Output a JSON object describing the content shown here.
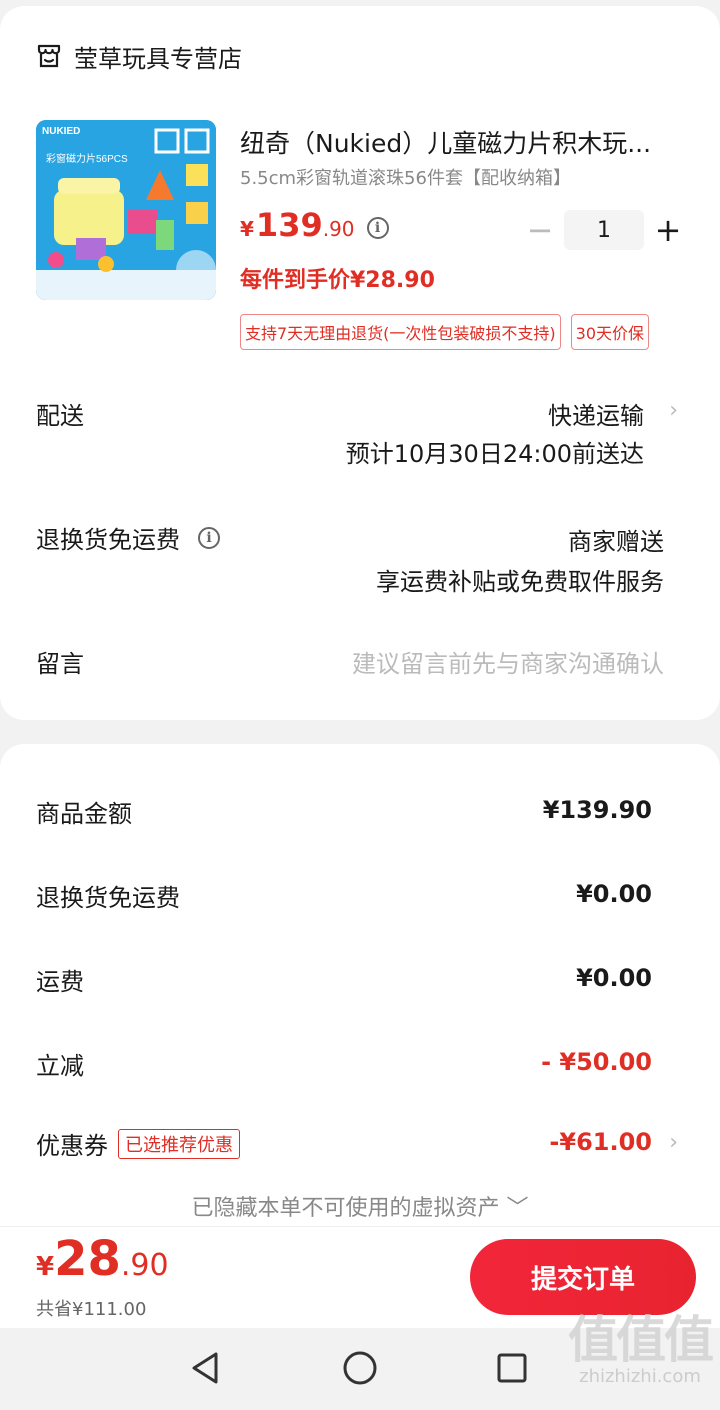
{
  "store": {
    "name": "莹草玩具专营店"
  },
  "product": {
    "title": "纽奇（Nukied）儿童磁力片积木玩...",
    "spec": "5.5cm彩窗轨道滚珠56件套【配收纳箱】",
    "price_symbol": "¥",
    "price_int": "139",
    "price_dec": ".90",
    "info_icon": "i",
    "quantity": "1",
    "minus_label": "−",
    "plus_label": "+",
    "unit_price": "每件到手价¥28.90",
    "image_brand": "NUKIED",
    "image_caption": "彩窗磁力片56PCS",
    "tags": [
      "支持7天无理由退货(一次性包装破损不支持)",
      "30天价保"
    ]
  },
  "delivery": {
    "label": "配送",
    "method": "快递运输",
    "eta": "预计10月30日24:00前送达"
  },
  "return_shipping": {
    "label": "退换货免运费",
    "info_icon": "i",
    "value": "商家赠送",
    "sub": "享运费补贴或免费取件服务"
  },
  "message": {
    "label": "留言",
    "placeholder": "建议留言前先与商家沟通确认"
  },
  "summary": {
    "goods_label": "商品金额",
    "goods_value": "¥139.90",
    "return_label": "退换货免运费",
    "return_value": "¥0.00",
    "freight_label": "运费",
    "freight_value": "¥0.00",
    "discount_label": "立减",
    "discount_value": "- ¥50.00",
    "coupon_label": "优惠券",
    "coupon_badge": "已选推荐优惠",
    "coupon_value": "-¥61.00",
    "hidden_note": "已隐藏本单不可使用的虚拟资产 ﹀"
  },
  "footer": {
    "total_symbol": "¥",
    "total_int": "28",
    "total_dec": ".90",
    "saved": "共省¥111.00",
    "submit": "提交订单"
  },
  "watermark": {
    "big": "值值值",
    "small": "zhizhizhi.com"
  },
  "colors": {
    "accent": "#e02e24",
    "button": "#ee2535",
    "background": "#f2f2f2"
  }
}
